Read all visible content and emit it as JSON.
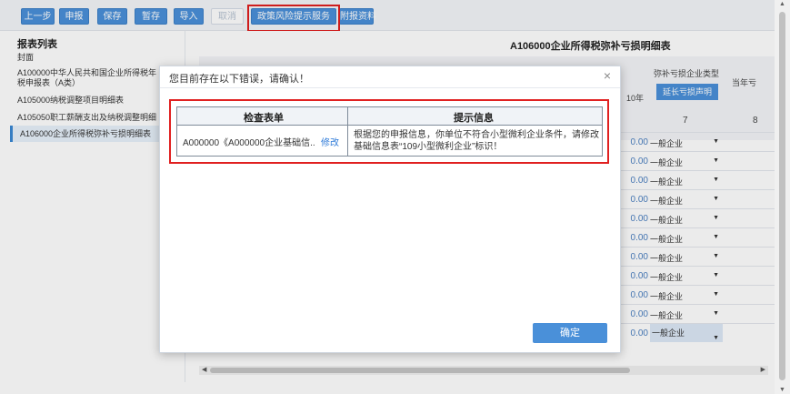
{
  "toolbar": {
    "buttons": [
      "上一步",
      "申报",
      "保存",
      "暂存",
      "导入",
      "取消",
      "政策风险提示服务",
      "附报资料"
    ]
  },
  "left_panel": {
    "title": "报表列表",
    "items": [
      "封面",
      "A100000中华人民共和国企业所得税年",
      "税申报表（A类）",
      "A105000纳税调整项目明细表",
      "A105050职工薪酬支出及纳税调整明细",
      "A106000企业所得税弥补亏损明细表"
    ]
  },
  "table": {
    "title": "A106000企业所得税弥补亏损明细表",
    "col_type_header": "弥补亏损企业类型",
    "col_current_header": "当年亏",
    "col_partial_header": "10年",
    "extend_button": "延长亏损声明",
    "col_numbers": [
      "7",
      "8"
    ],
    "rows": [
      {
        "value": "0.00",
        "type": "一般企业"
      },
      {
        "value": "0.00",
        "type": "一般企业"
      },
      {
        "value": "0.00",
        "type": "一般企业"
      },
      {
        "value": "0.00",
        "type": "一般企业"
      },
      {
        "value": "0.00",
        "type": "一般企业"
      },
      {
        "value": "0.00",
        "type": "一般企业"
      },
      {
        "value": "0.00",
        "type": "一般企业"
      },
      {
        "value": "0.00",
        "type": "一般企业"
      },
      {
        "value": "0.00",
        "type": "一般企业"
      },
      {
        "value": "0.00",
        "type": "一般企业"
      },
      {
        "value": "0.00",
        "type": "一般企业"
      }
    ]
  },
  "dialog": {
    "title": "您目前存在以下错误，请确认！",
    "col_form": "检查表单",
    "col_info": "提示信息",
    "error_form": "A000000《A000000企业基础信..",
    "error_link": "修改",
    "error_message": "根据您的申报信息，你单位不符合小型微利企业条件，请修改基础信息表“109小型微利企业”标识！",
    "ok_button": "确定"
  },
  "colors": {
    "primary_button": "#4a90d9",
    "highlight_border": "#e02020",
    "link": "#2f7bd8"
  }
}
